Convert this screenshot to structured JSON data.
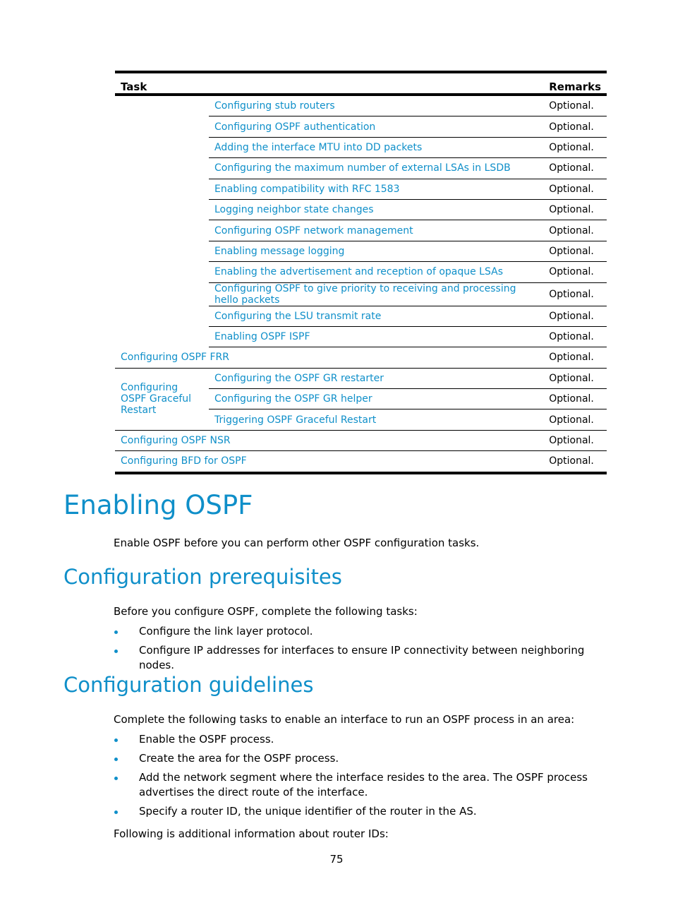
{
  "table": {
    "headers": {
      "task": "Task",
      "remarks": "Remarks"
    },
    "subrows_group1": [
      {
        "task": "Configuring stub routers",
        "remarks": "Optional."
      },
      {
        "task": "Configuring OSPF authentication",
        "remarks": "Optional."
      },
      {
        "task": "Adding the interface MTU into DD packets",
        "remarks": "Optional."
      },
      {
        "task": "Configuring the maximum number of external LSAs in LSDB",
        "remarks": "Optional."
      },
      {
        "task": "Enabling compatibility with RFC 1583",
        "remarks": "Optional."
      },
      {
        "task": "Logging neighbor state changes",
        "remarks": "Optional."
      },
      {
        "task": "Configuring OSPF network management",
        "remarks": "Optional."
      },
      {
        "task": "Enabling message logging",
        "remarks": "Optional."
      },
      {
        "task": "Enabling the advertisement and reception of opaque LSAs",
        "remarks": "Optional."
      },
      {
        "task": "Configuring OSPF to give priority to receiving and processing hello packets",
        "remarks": "Optional."
      },
      {
        "task": "Configuring the LSU transmit rate",
        "remarks": "Optional."
      },
      {
        "task": "Enabling OSPF ISPF",
        "remarks": "Optional."
      }
    ],
    "frr": {
      "task": "Configuring OSPF FRR",
      "remarks": "Optional."
    },
    "gr_group": {
      "label": "Configuring OSPF Graceful Restart",
      "rows": [
        {
          "task": "Configuring the OSPF GR restarter",
          "remarks": "Optional."
        },
        {
          "task": "Configuring the OSPF GR helper",
          "remarks": "Optional."
        },
        {
          "task": "Triggering OSPF Graceful Restart",
          "remarks": "Optional."
        }
      ]
    },
    "nsr": {
      "task": "Configuring OSPF NSR",
      "remarks": "Optional."
    },
    "bfd": {
      "task": "Configuring BFD for OSPF",
      "remarks": "Optional."
    }
  },
  "section1": {
    "title": "Enabling OSPF",
    "text": "Enable OSPF before you can perform other OSPF configuration tasks."
  },
  "section2": {
    "title": "Configuration prerequisites",
    "intro": "Before you configure OSPF, complete the following tasks:",
    "bullets": [
      "Configure the link layer protocol.",
      "Configure IP addresses for interfaces to ensure IP connectivity between neighboring nodes."
    ]
  },
  "section3": {
    "title": "Configuration guidelines",
    "intro": "Complete the following tasks to enable an interface to run an OSPF process in an area:",
    "bullets": [
      "Enable the OSPF process.",
      "Create the area for the OSPF process.",
      "Add the network segment where the interface resides to the area. The OSPF process advertises the direct route of the interface.",
      "Specify a router ID, the unique identifier of the router in the AS."
    ],
    "outro": "Following is additional information about router IDs:"
  },
  "page_number": "75"
}
